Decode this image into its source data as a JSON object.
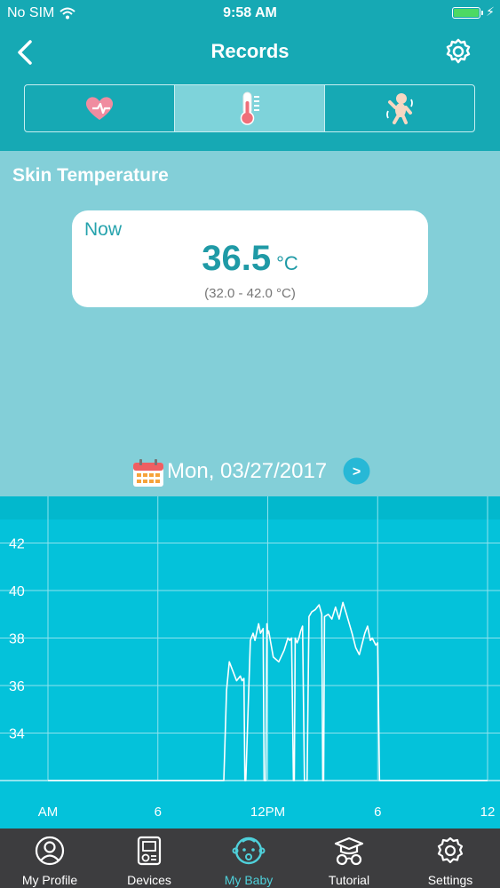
{
  "status_bar": {
    "carrier": "No SIM",
    "time": "9:58 AM"
  },
  "nav": {
    "title": "Records"
  },
  "segments": [
    {
      "icon": "heart-pulse-icon",
      "active": false
    },
    {
      "icon": "thermometer-icon",
      "active": true
    },
    {
      "icon": "baby-movement-icon",
      "active": false
    }
  ],
  "section": {
    "title": "Skin Temperature"
  },
  "now_card": {
    "label": "Now",
    "value": "36.5",
    "unit": "°C",
    "range": "(32.0 - 42.0 °C)"
  },
  "date": {
    "text": "Mon, 03/27/2017",
    "next_label": ">"
  },
  "colors": {
    "header": "#16a9b4",
    "content": "#83cfd8",
    "chart_bg": "#04c2da",
    "tab_bar": "#3d3d3f",
    "accent": "#4fd0da"
  },
  "chart_data": {
    "type": "line",
    "title": "",
    "xlabel": "",
    "ylabel": "",
    "x_ticks": [
      "AM",
      "6",
      "12PM",
      "6",
      "12"
    ],
    "y_ticks": [
      34,
      36,
      38,
      40,
      42
    ],
    "ylim": [
      32,
      43
    ],
    "xlim": [
      0,
      24
    ],
    "grid": true,
    "series": [
      {
        "x": [
          0,
          9.6,
          9.75,
          9.9,
          10.1,
          10.3,
          10.5,
          10.6,
          10.7,
          10.75,
          10.8,
          11.05,
          11.1,
          11.2,
          11.3,
          11.5,
          11.6,
          11.75,
          11.8,
          11.9,
          11.95,
          12.0,
          12.05,
          12.3,
          12.6,
          12.9,
          13.1,
          13.2,
          13.3,
          13.4,
          13.45,
          13.5,
          13.6,
          13.7,
          13.8,
          13.9,
          14.0,
          14.15,
          14.25,
          14.4,
          14.6,
          14.8,
          14.95,
          15.0,
          15.05,
          15.1,
          15.3,
          15.5,
          15.7,
          15.9,
          16.1,
          16.3,
          16.6,
          16.8,
          17.0,
          17.3,
          17.45,
          17.6,
          17.7,
          17.9,
          18.0,
          18.1,
          18.3,
          18.5,
          18.7,
          18.8,
          24
        ],
        "y": [
          32,
          32,
          35.8,
          37.0,
          36.6,
          36.2,
          36.4,
          36.2,
          36.3,
          32,
          32,
          37.9,
          38.0,
          38.2,
          37.9,
          38.6,
          38.2,
          38.4,
          32,
          32,
          38.6,
          38.2,
          38.3,
          37.2,
          37.0,
          37.5,
          38.0,
          37.9,
          38.0,
          32,
          32,
          38.0,
          37.8,
          38.0,
          38.3,
          38.5,
          32,
          32,
          38.9,
          39.1,
          39.2,
          39.4,
          39.0,
          32,
          32,
          38.9,
          39.0,
          38.8,
          39.3,
          38.8,
          39.5,
          39.0,
          38.2,
          37.6,
          37.3,
          38.2,
          38.5,
          37.9,
          38.0,
          37.7,
          37.8,
          32,
          32,
          32,
          32,
          32,
          32
        ]
      }
    ]
  },
  "tabs": [
    {
      "label": "My Profile",
      "icon": "person-icon",
      "active": false
    },
    {
      "label": "Devices",
      "icon": "device-icon",
      "active": false
    },
    {
      "label": "My Baby",
      "icon": "baby-face-icon",
      "active": true
    },
    {
      "label": "Tutorial",
      "icon": "graduation-glasses-icon",
      "active": false
    },
    {
      "label": "Settings",
      "icon": "gear-icon",
      "active": false
    }
  ]
}
